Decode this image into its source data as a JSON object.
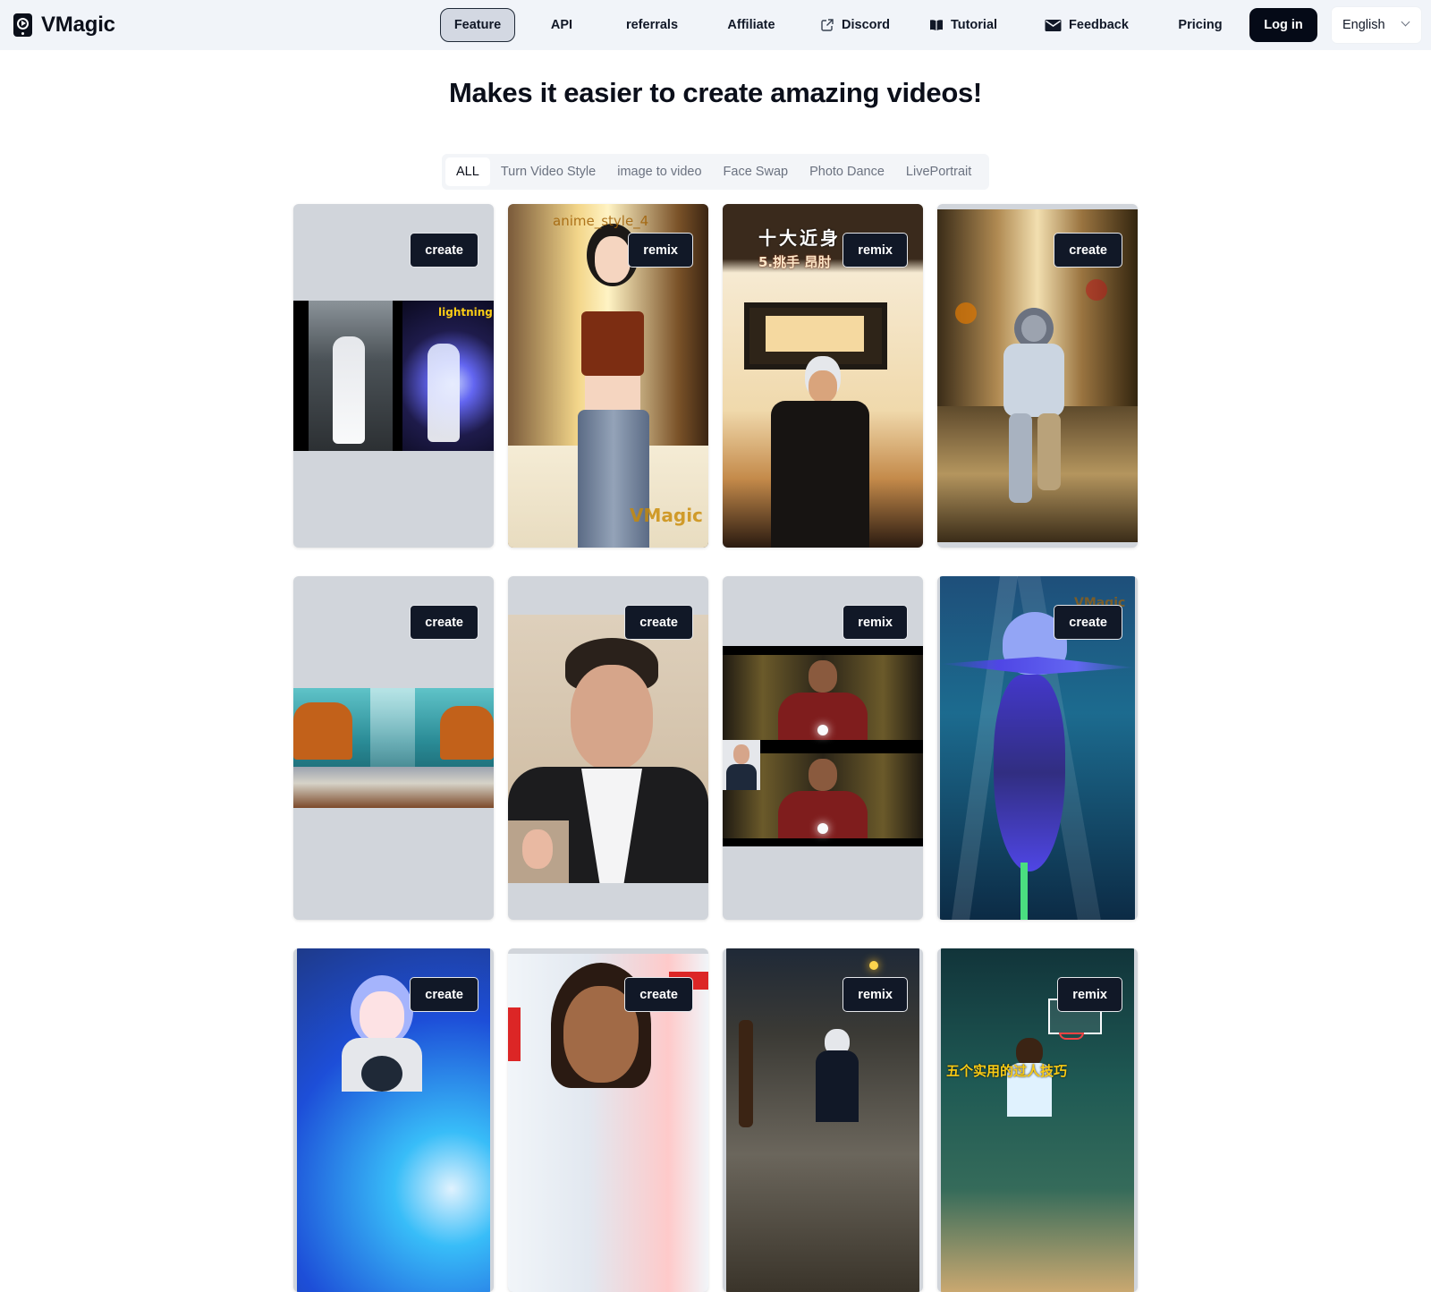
{
  "header": {
    "brand": "VMagic",
    "nav": [
      {
        "label": "Feature",
        "icon": null,
        "active": true
      },
      {
        "label": "API",
        "icon": null,
        "active": false
      },
      {
        "label": "referrals",
        "icon": null,
        "active": false
      },
      {
        "label": "Affiliate",
        "icon": null,
        "active": false
      },
      {
        "label": "Discord",
        "icon": "external-link-icon",
        "active": false
      },
      {
        "label": "Tutorial",
        "icon": "book-icon",
        "active": false
      },
      {
        "label": "Feedback",
        "icon": "envelope-icon",
        "active": false
      },
      {
        "label": "Pricing",
        "icon": null,
        "active": false
      }
    ],
    "login_label": "Log in",
    "language": "English"
  },
  "title": "Makes it easier to create amazing videos!",
  "tabs": [
    {
      "label": "ALL",
      "active": true
    },
    {
      "label": "Turn Video Style",
      "active": false
    },
    {
      "label": "image to video",
      "active": false
    },
    {
      "label": "Face Swap",
      "active": false
    },
    {
      "label": "Photo Dance",
      "active": false
    },
    {
      "label": "LivePortrait",
      "active": false
    }
  ],
  "cards": [
    {
      "button": "create",
      "subject": "dancer lightning style transfer",
      "overlay": "lightning"
    },
    {
      "button": "remix",
      "subject": "anime woman in red top",
      "overlay": "anime_style_4",
      "watermark": "VMagic"
    },
    {
      "button": "remix",
      "subject": "martial arts anime man",
      "overlay": "十大近身",
      "overlay2": "5.挑手 昂肘"
    },
    {
      "button": "create",
      "subject": "astronaut running in street"
    },
    {
      "button": "create",
      "subject": "underwater city"
    },
    {
      "button": "create",
      "subject": "live portrait man face"
    },
    {
      "button": "remix",
      "subject": "iron man face swap"
    },
    {
      "button": "create",
      "subject": "blue underwater flower",
      "watermark": "VMagic"
    },
    {
      "button": "create",
      "subject": "anime girl blue background"
    },
    {
      "button": "create",
      "subject": "smiling woman at TED"
    },
    {
      "button": "remix",
      "subject": "anime man with wooden dummy"
    },
    {
      "button": "remix",
      "subject": "basketball anime",
      "overlay": "五个实用的过人技巧"
    }
  ]
}
